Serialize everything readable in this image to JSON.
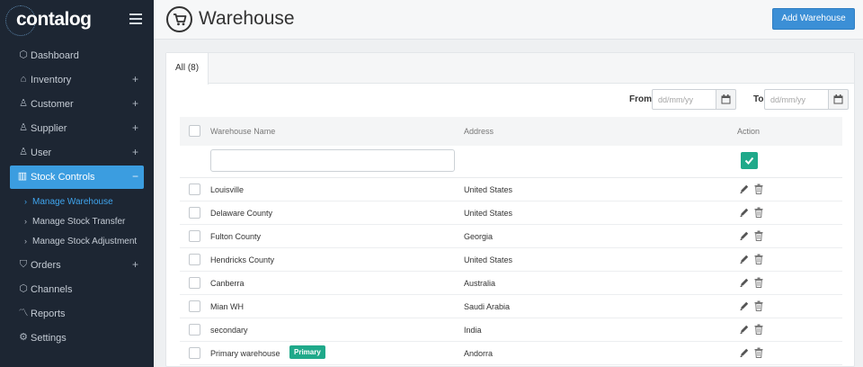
{
  "app": {
    "logo_text": "contalog"
  },
  "sidebar": {
    "items": [
      {
        "label": "Dashboard",
        "icon": "cube-icon",
        "has_plus": false
      },
      {
        "label": "Inventory",
        "icon": "basket-icon",
        "has_plus": true
      },
      {
        "label": "Customer",
        "icon": "user-icon",
        "has_plus": true
      },
      {
        "label": "Supplier",
        "icon": "user-icon",
        "has_plus": true
      },
      {
        "label": "User",
        "icon": "user-icon",
        "has_plus": true
      },
      {
        "label": "Stock Controls",
        "icon": "chart-icon",
        "has_plus": true,
        "expanded_symbol": "−",
        "active": true
      },
      {
        "label": "Orders",
        "icon": "bag-icon",
        "has_plus": true
      },
      {
        "label": "Channels",
        "icon": "cubes-icon",
        "has_plus": false
      },
      {
        "label": "Reports",
        "icon": "line-chart-icon",
        "has_plus": false
      },
      {
        "label": "Settings",
        "icon": "cogs-icon",
        "has_plus": false
      }
    ],
    "sub_items": [
      {
        "label": "Manage Warehouse",
        "current": true
      },
      {
        "label": "Manage Stock Transfer",
        "current": false
      },
      {
        "label": "Manage Stock Adjustment",
        "current": false
      }
    ],
    "plus_symbol": "+",
    "chevron_symbol": "›"
  },
  "header": {
    "title": "Warehouse",
    "icon": "shopping-cart-icon",
    "add_button_label": "Add Warehouse"
  },
  "tabs": [
    {
      "label": "All (8)",
      "active": true
    }
  ],
  "filters": {
    "from_label": "From",
    "to_label": "To",
    "date_placeholder": "dd/mm/yy"
  },
  "table": {
    "columns": {
      "name": "Warehouse Name",
      "address": "Address",
      "action": "Action"
    },
    "rows": [
      {
        "name": "Louisville",
        "address": "United States"
      },
      {
        "name": "Delaware County",
        "address": "United States"
      },
      {
        "name": "Fulton County",
        "address": "Georgia"
      },
      {
        "name": "Hendricks County",
        "address": "United States"
      },
      {
        "name": "Canberra",
        "address": "Australia"
      },
      {
        "name": "Mian WH",
        "address": "Saudi Arabia"
      },
      {
        "name": "secondary",
        "address": "India"
      },
      {
        "name": "Primary warehouse",
        "address": "Andorra",
        "badge": "Primary"
      }
    ]
  },
  "colors": {
    "sidebar_bg": "#1d2633",
    "active_blue": "#3b9de0",
    "button_blue": "#3b8fd6",
    "success_green": "#1fa98a"
  }
}
